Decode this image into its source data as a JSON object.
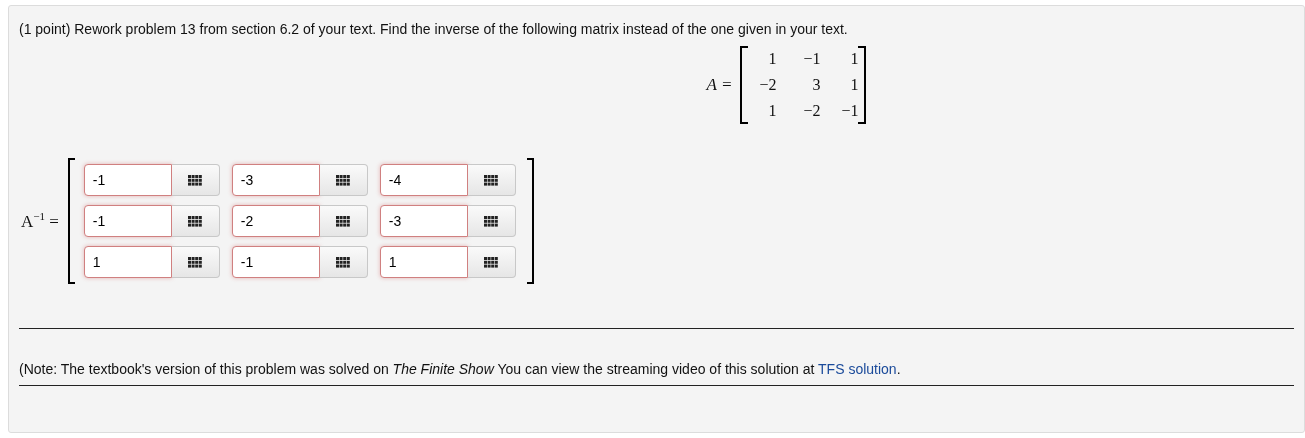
{
  "question": "(1 point) Rework problem 13 from section 6.2 of your text. Find the inverse of the following matrix instead of the one given in your text.",
  "matrix": {
    "label": "A =",
    "rows": [
      [
        "1",
        "−1",
        "1"
      ],
      [
        "−2",
        "3",
        "1"
      ],
      [
        "1",
        "−2",
        "−1"
      ]
    ]
  },
  "answer": {
    "label": "A",
    "sup": "−1",
    "eq": "=",
    "rows": [
      [
        {
          "value": "-1",
          "invalid": true
        },
        {
          "value": "-3",
          "invalid": true
        },
        {
          "value": "-4",
          "invalid": true
        }
      ],
      [
        {
          "value": "-1",
          "invalid": true
        },
        {
          "value": "-2",
          "invalid": true
        },
        {
          "value": "-3",
          "invalid": true
        }
      ],
      [
        {
          "value": "1",
          "invalid": true
        },
        {
          "value": "-1",
          "invalid": true
        },
        {
          "value": "1",
          "invalid": true
        }
      ]
    ]
  },
  "note": {
    "text": "(Note: The textbook's version of this problem was solved on *The Finite Show* You can view the streaming video of this solution at ",
    "link": "TFS solution",
    "end": "."
  }
}
